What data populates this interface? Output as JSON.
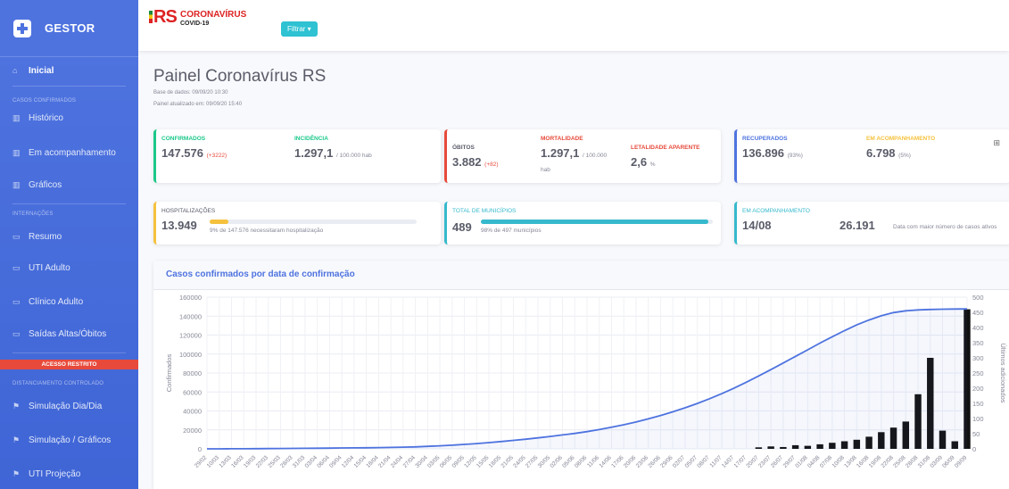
{
  "sidebar": {
    "brand": "GESTOR",
    "items": [
      {
        "label": "Inicial",
        "icon": "home-icon",
        "active": true
      },
      {
        "label": "Histórico",
        "icon": "chart-icon"
      },
      {
        "label": "Em acompanhamento",
        "icon": "chart-icon"
      },
      {
        "label": "Gráficos",
        "icon": "chart-icon"
      },
      {
        "label": "Resumo",
        "icon": "bed-icon"
      },
      {
        "label": "UTI Adulto",
        "icon": "bed-icon"
      },
      {
        "label": "Clínico Adulto",
        "icon": "bed-icon"
      },
      {
        "label": "Saídas Altas/Óbitos",
        "icon": "bed-icon"
      },
      {
        "label": "Simulação Dia/Dia",
        "icon": "flag-icon"
      },
      {
        "label": "Simulação / Gráficos",
        "icon": "flag-icon"
      },
      {
        "label": "UTI Projeção",
        "icon": "flag-icon"
      }
    ],
    "headings": {
      "casos": "CASOS CONFIRMADOS",
      "internacoes": "INTERNAÇÕES",
      "distanciamento": "DISTANCIAMENTO CONTROLADO"
    },
    "restricted": "ACESSO RESTRITO"
  },
  "topbar": {
    "logo": "RS",
    "title": "CORONAVÍRUS",
    "subtitle": "COVID-19",
    "filter": "Filtrar ▾"
  },
  "page": {
    "title": "Painel Coronavírus RS",
    "base": "Base de dados: 09/09/20 10:30",
    "updated": "Painel atualizado em: 09/09/20 15:40"
  },
  "cards": {
    "confirmados": {
      "label": "CONFIRMADOS",
      "value": "147.576",
      "delta": "(+3222)"
    },
    "incidencia": {
      "label": "INCIDÊNCIA",
      "value": "1.297,1",
      "unit": "/ 100.000 hab"
    },
    "obitos": {
      "label": "ÓBITOS",
      "value": "3.882",
      "delta": "(+82)"
    },
    "mortalidade": {
      "label": "MORTALIDADE",
      "value": "1.297,1",
      "unit": "/ 100.000",
      "unit2": "hab"
    },
    "letalidade": {
      "label": "LETALIDADE APARENTE",
      "value": "2,6",
      "unit": "%"
    },
    "recuperados": {
      "label": "RECUPERADOS",
      "value": "136.896",
      "pct": "(93%)"
    },
    "emacomp": {
      "label": "EM ACOMPANHAMENTO",
      "value": "6.798",
      "pct": "(5%)"
    },
    "hosp": {
      "label": "HOSPITALIZAÇÕES",
      "value": "13.949",
      "note": "9% de 147.576 necessitaram hospitalização",
      "progress": 0.09
    },
    "municipios": {
      "label": "TOTAL DE MUNICÍPIOS",
      "value": "489",
      "note": "98% de 497 municípios",
      "progress": 0.98
    },
    "pico": {
      "label": "EM ACOMPANHAMENTO",
      "date": "14/08",
      "value": "26.191",
      "note": "Data com maior número de casos ativos"
    }
  },
  "colors": {
    "primary": "#4e73df",
    "success": "#1cc88a",
    "danger": "#e74a3b",
    "warning": "#f6c23e",
    "info": "#36b9cc"
  },
  "chart_data": {
    "type": "line",
    "title": "Casos confirmados por data de confirmação",
    "ylabel": "Confirmados",
    "y2label": "Últimos adicionados",
    "ylim": [
      0,
      160000
    ],
    "y2lim": [
      0,
      500
    ],
    "yticks": [
      0,
      20000,
      40000,
      60000,
      80000,
      100000,
      120000,
      140000,
      160000
    ],
    "y2ticks": [
      0,
      50,
      100,
      150,
      200,
      250,
      300,
      350,
      400,
      450,
      500
    ],
    "x": [
      "29/02",
      "10/03",
      "13/03",
      "16/03",
      "19/03",
      "22/03",
      "25/03",
      "28/03",
      "31/03",
      "03/04",
      "06/04",
      "09/04",
      "12/04",
      "15/04",
      "18/04",
      "21/04",
      "24/04",
      "27/04",
      "30/04",
      "03/05",
      "06/05",
      "09/05",
      "12/05",
      "15/05",
      "18/05",
      "21/05",
      "24/05",
      "27/05",
      "30/05",
      "02/06",
      "05/06",
      "08/06",
      "11/06",
      "14/06",
      "17/06",
      "20/06",
      "23/06",
      "26/06",
      "29/06",
      "02/07",
      "05/07",
      "08/07",
      "11/07",
      "14/07",
      "17/07",
      "20/07",
      "23/07",
      "26/07",
      "29/07",
      "01/08",
      "04/08",
      "07/08",
      "10/08",
      "13/08",
      "16/08",
      "19/08",
      "22/08",
      "25/08",
      "28/08",
      "31/08",
      "03/09",
      "06/09",
      "09/09"
    ],
    "series": [
      {
        "name": "Confirmados",
        "type": "line",
        "values": [
          1,
          20,
          50,
          100,
          200,
          300,
          400,
          500,
          600,
          700,
          800,
          900,
          1000,
          1100,
          1300,
          1500,
          1800,
          2100,
          2600,
          3200,
          3900,
          4700,
          5600,
          6600,
          7700,
          8900,
          10200,
          11600,
          13100,
          14700,
          16300,
          18200,
          20300,
          22800,
          25400,
          28300,
          31600,
          35200,
          39100,
          43300,
          47900,
          52900,
          58300,
          64100,
          70300,
          76900,
          83600,
          90500,
          97500,
          104500,
          111500,
          118200,
          124700,
          130700,
          135900,
          140300,
          143700,
          145600,
          146500,
          147000,
          147300,
          147500,
          147576
        ]
      },
      {
        "name": "Últimos adicionados",
        "type": "bar",
        "values": [
          0,
          0,
          0,
          0,
          0,
          0,
          0,
          0,
          0,
          0,
          0,
          0,
          0,
          0,
          0,
          0,
          0,
          0,
          0,
          0,
          0,
          0,
          0,
          0,
          0,
          0,
          0,
          0,
          0,
          0,
          0,
          0,
          0,
          0,
          0,
          0,
          0,
          0,
          0,
          0,
          0,
          0,
          0,
          0,
          0,
          5,
          8,
          6,
          12,
          10,
          15,
          20,
          25,
          30,
          40,
          55,
          70,
          90,
          180,
          300,
          60,
          25,
          460
        ]
      }
    ]
  }
}
